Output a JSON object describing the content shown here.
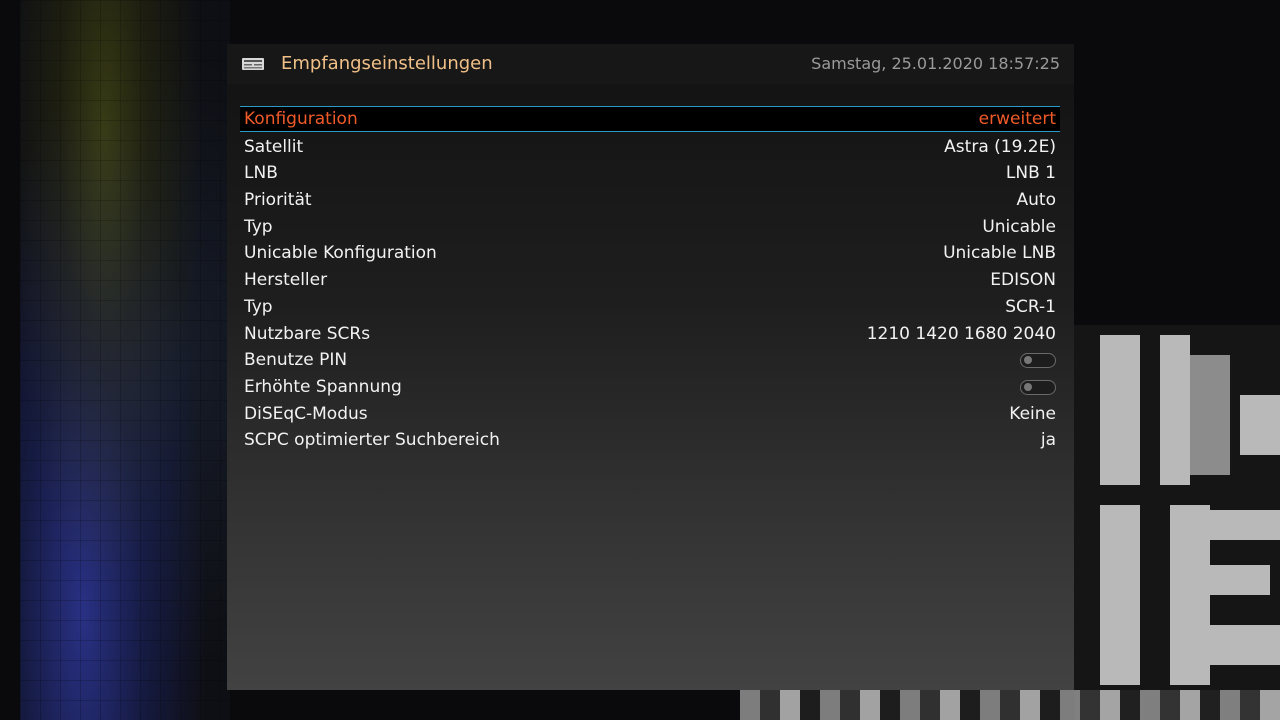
{
  "header": {
    "title": "Empfangseinstellungen",
    "datetime": "Samstag, 25.01.2020  18:57:25",
    "icon": "satellite-dish-icon"
  },
  "settings": [
    {
      "label": "Konfiguration",
      "value": "erweitert",
      "selected": true
    },
    {
      "label": "Satellit",
      "value": "Astra (19.2E)"
    },
    {
      "label": "LNB",
      "value": "LNB 1"
    },
    {
      "label": "Priorität",
      "value": "Auto"
    },
    {
      "label": "Typ",
      "value": "Unicable"
    },
    {
      "label": "Unicable Konfiguration",
      "value": "Unicable LNB"
    },
    {
      "label": "Hersteller",
      "value": "EDISON"
    },
    {
      "label": "Typ",
      "value": "SCR-1"
    },
    {
      "label": "Nutzbare SCRs",
      "value": "1210 1420 1680 2040"
    },
    {
      "label": "Benutze PIN",
      "toggle": false
    },
    {
      "label": "Erhöhte Spannung",
      "toggle": false
    },
    {
      "label": "DiSEqC-Modus",
      "value": "Keine"
    },
    {
      "label": "SCPC optimierter Suchbereich",
      "value": "ja"
    }
  ],
  "colors": {
    "accent": "#f05a28",
    "selection_border": "#2a9ac6",
    "title": "#f0c088"
  }
}
